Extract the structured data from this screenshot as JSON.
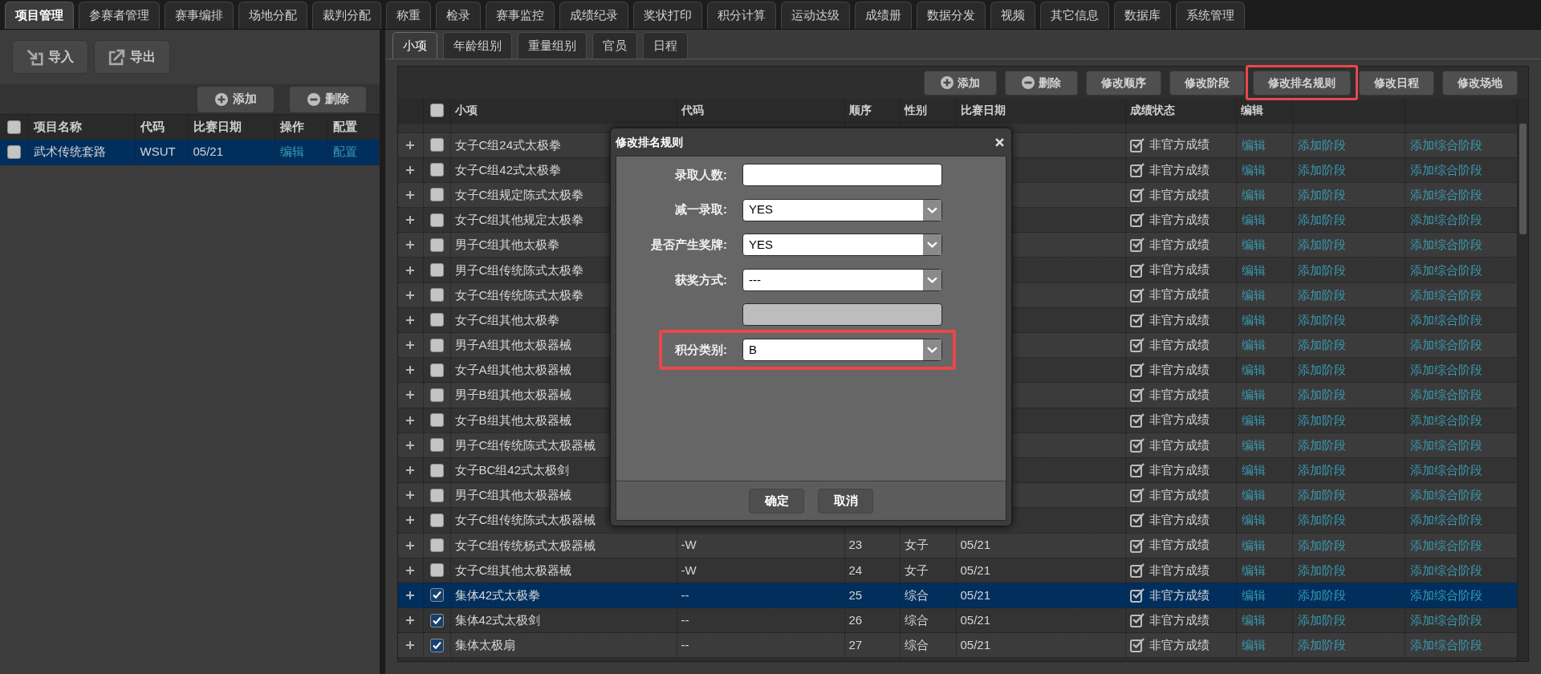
{
  "main_tabs": [
    {
      "label": "项目管理",
      "selected": true
    },
    {
      "label": "参赛者管理",
      "selected": false
    },
    {
      "label": "赛事编排",
      "selected": false
    },
    {
      "label": "场地分配",
      "selected": false
    },
    {
      "label": "裁判分配",
      "selected": false
    },
    {
      "label": "称重",
      "selected": false
    },
    {
      "label": "检录",
      "selected": false
    },
    {
      "label": "赛事监控",
      "selected": false
    },
    {
      "label": "成绩纪录",
      "selected": false
    },
    {
      "label": "奖状打印",
      "selected": false
    },
    {
      "label": "积分计算",
      "selected": false
    },
    {
      "label": "运动达级",
      "selected": false
    },
    {
      "label": "成绩册",
      "selected": false
    },
    {
      "label": "数据分发",
      "selected": false
    },
    {
      "label": "视频",
      "selected": false
    },
    {
      "label": "其它信息",
      "selected": false
    },
    {
      "label": "数据库",
      "selected": false
    },
    {
      "label": "系统管理",
      "selected": false
    }
  ],
  "project_panel": {
    "file_buttons": [
      {
        "label": "导入",
        "kind": "import"
      },
      {
        "label": "导出",
        "kind": "export"
      }
    ],
    "actions": [
      {
        "label": "添加",
        "kind": "add"
      },
      {
        "label": "删除",
        "kind": "delete"
      }
    ],
    "table": {
      "all_checked": false,
      "columns": [
        "项目名称",
        "代码",
        "比赛日期",
        "操作",
        "配置"
      ],
      "rows": [
        {
          "checked": false,
          "selected": true,
          "name": "武术传统套路",
          "code": "WSUT",
          "date": "05/21",
          "edit": "编辑",
          "config": "配置"
        }
      ]
    }
  },
  "event_panel": {
    "tabs": [
      {
        "label": "小项",
        "selected": true
      },
      {
        "label": "年龄组别",
        "selected": false
      },
      {
        "label": "重量组别",
        "selected": false
      },
      {
        "label": "官员",
        "selected": false
      },
      {
        "label": "日程",
        "selected": false
      }
    ],
    "toolbar": [
      {
        "label": "添加",
        "kind": "add",
        "highlighted": false
      },
      {
        "label": "删除",
        "kind": "delete",
        "highlighted": false
      },
      {
        "label": "修改顺序",
        "kind": "plain",
        "highlighted": false
      },
      {
        "label": "修改阶段",
        "kind": "plain",
        "highlighted": false
      },
      {
        "label": "修改排名规则",
        "kind": "plain",
        "highlighted": true
      },
      {
        "label": "修改日程",
        "kind": "plain",
        "highlighted": false
      },
      {
        "label": "修改场地",
        "kind": "plain",
        "highlighted": false
      }
    ],
    "table": {
      "all_checked": false,
      "columns": [
        "小项",
        "代码",
        "顺序",
        "性别",
        "比赛日期",
        "成绩状态",
        "编辑"
      ],
      "rows": [
        {
          "name": "女子C组24式太极拳",
          "checked": false,
          "selected": false,
          "status": "非官方成绩",
          "edit": "编辑",
          "add_stage": "添加阶段",
          "add_composite": "添加综合阶段"
        },
        {
          "name": "女子C组42式太极拳",
          "checked": false,
          "selected": false,
          "status": "非官方成绩",
          "edit": "编辑",
          "add_stage": "添加阶段",
          "add_composite": "添加综合阶段"
        },
        {
          "name": "女子C组规定陈式太极拳",
          "checked": false,
          "selected": false,
          "status": "非官方成绩",
          "edit": "编辑",
          "add_stage": "添加阶段",
          "add_composite": "添加综合阶段"
        },
        {
          "name": "女子C组其他规定太极拳",
          "checked": false,
          "selected": false,
          "status": "非官方成绩",
          "edit": "编辑",
          "add_stage": "添加阶段",
          "add_composite": "添加综合阶段"
        },
        {
          "name": "男子C组其他太极拳",
          "checked": false,
          "selected": false,
          "status": "非官方成绩",
          "edit": "编辑",
          "add_stage": "添加阶段",
          "add_composite": "添加综合阶段"
        },
        {
          "name": "男子C组传统陈式太极拳",
          "checked": false,
          "selected": false,
          "status": "非官方成绩",
          "edit": "编辑",
          "add_stage": "添加阶段",
          "add_composite": "添加综合阶段"
        },
        {
          "name": "女子C组传统陈式太极拳",
          "checked": false,
          "selected": false,
          "status": "非官方成绩",
          "edit": "编辑",
          "add_stage": "添加阶段",
          "add_composite": "添加综合阶段"
        },
        {
          "name": "女子C组其他太极拳",
          "checked": false,
          "selected": false,
          "status": "非官方成绩",
          "edit": "编辑",
          "add_stage": "添加阶段",
          "add_composite": "添加综合阶段"
        },
        {
          "name": "男子A组其他太极器械",
          "checked": false,
          "selected": false,
          "status": "非官方成绩",
          "edit": "编辑",
          "add_stage": "添加阶段",
          "add_composite": "添加综合阶段"
        },
        {
          "name": "女子A组其他太极器械",
          "checked": false,
          "selected": false,
          "status": "非官方成绩",
          "edit": "编辑",
          "add_stage": "添加阶段",
          "add_composite": "添加综合阶段"
        },
        {
          "name": "男子B组其他太极器械",
          "checked": false,
          "selected": false,
          "status": "非官方成绩",
          "edit": "编辑",
          "add_stage": "添加阶段",
          "add_composite": "添加综合阶段"
        },
        {
          "name": "女子B组其他太极器械",
          "checked": false,
          "selected": false,
          "status": "非官方成绩",
          "edit": "编辑",
          "add_stage": "添加阶段",
          "add_composite": "添加综合阶段"
        },
        {
          "name": "男子C组传统陈式太极器械",
          "checked": false,
          "selected": false,
          "status": "非官方成绩",
          "edit": "编辑",
          "add_stage": "添加阶段",
          "add_composite": "添加综合阶段"
        },
        {
          "name": "女子BC组42式太极剑",
          "checked": false,
          "selected": false,
          "status": "非官方成绩",
          "edit": "编辑",
          "add_stage": "添加阶段",
          "add_composite": "添加综合阶段"
        },
        {
          "name": "男子C组其他太极器械",
          "checked": false,
          "selected": false,
          "status": "非官方成绩",
          "edit": "编辑",
          "add_stage": "添加阶段",
          "add_composite": "添加综合阶段"
        },
        {
          "name": "女子C组传统陈式太极器械",
          "checked": false,
          "selected": false,
          "status": "非官方成绩",
          "edit": "编辑",
          "add_stage": "添加阶段",
          "add_composite": "添加综合阶段"
        },
        {
          "name": "女子C组传统杨式太极器械",
          "code": "-W",
          "order": "23",
          "gender": "女子",
          "date": "05/21",
          "checked": false,
          "selected": false,
          "status": "非官方成绩",
          "edit": "编辑",
          "add_stage": "添加阶段",
          "add_composite": "添加综合阶段"
        },
        {
          "name": "女子C组其他太极器械",
          "code": "-W",
          "order": "24",
          "gender": "女子",
          "date": "05/21",
          "checked": false,
          "selected": false,
          "status": "非官方成绩",
          "edit": "编辑",
          "add_stage": "添加阶段",
          "add_composite": "添加综合阶段"
        },
        {
          "name": "集体42式太极拳",
          "code": "--",
          "order": "25",
          "gender": "综合",
          "date": "05/21",
          "checked": true,
          "selected": true,
          "status": "非官方成绩",
          "edit": "编辑",
          "add_stage": "添加阶段",
          "add_composite": "添加综合阶段"
        },
        {
          "name": "集体42式太极剑",
          "code": "--",
          "order": "26",
          "gender": "综合",
          "date": "05/21",
          "checked": true,
          "selected": false,
          "status": "非官方成绩",
          "edit": "编辑",
          "add_stage": "添加阶段",
          "add_composite": "添加综合阶段"
        },
        {
          "name": "集体太极扇",
          "code": "--",
          "order": "27",
          "gender": "综合",
          "date": "05/21",
          "checked": true,
          "selected": false,
          "status": "非官方成绩",
          "edit": "编辑",
          "add_stage": "添加阶段",
          "add_composite": "添加综合阶段"
        }
      ]
    }
  },
  "dialog": {
    "title": "修改排名规则",
    "fields": [
      {
        "label": "录取人数:",
        "kind": "text",
        "disabled": false,
        "highlighted": false
      },
      {
        "label": "减一录取:",
        "kind": "select",
        "value": "YES",
        "disabled": false,
        "highlighted": false
      },
      {
        "label": "是否产生奖牌:",
        "kind": "select",
        "value": "YES",
        "disabled": false,
        "highlighted": false
      },
      {
        "label": "获奖方式:",
        "kind": "select",
        "value": "---",
        "disabled": false,
        "highlighted": false
      },
      {
        "kind": "text",
        "disabled": true,
        "highlighted": false
      },
      {
        "label": "积分类别:",
        "kind": "select",
        "value": "B",
        "disabled": false,
        "highlighted": true
      }
    ],
    "buttons": [
      "确定",
      "取消"
    ]
  }
}
